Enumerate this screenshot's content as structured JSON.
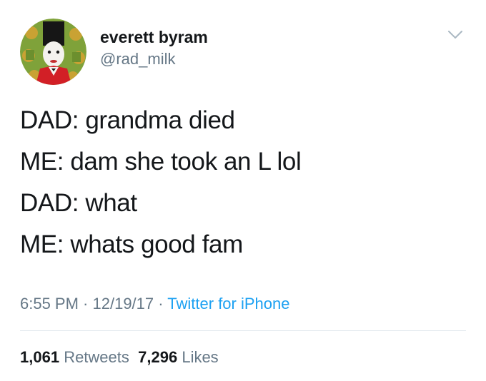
{
  "author": {
    "display_name": "everett byram",
    "handle": "@rad_milk"
  },
  "icons": {
    "avatar": "avatar-image",
    "menu": "chevron-down-icon"
  },
  "tweet": {
    "lines": [
      "DAD: grandma died",
      "ME: dam she took an L lol",
      "DAD: what",
      "ME: whats good fam"
    ]
  },
  "meta": {
    "time": "6:55 PM",
    "sep1": " · ",
    "date": "12/19/17",
    "sep2": " · ",
    "source": "Twitter for iPhone"
  },
  "stats": {
    "retweets_count": "1,061",
    "retweets_label": "Retweets",
    "likes_count": "7,296",
    "likes_label": "Likes"
  },
  "colors": {
    "text": "#14171a",
    "secondary": "#657786",
    "link": "#1da1f2",
    "divider": "#e1e8ed"
  }
}
